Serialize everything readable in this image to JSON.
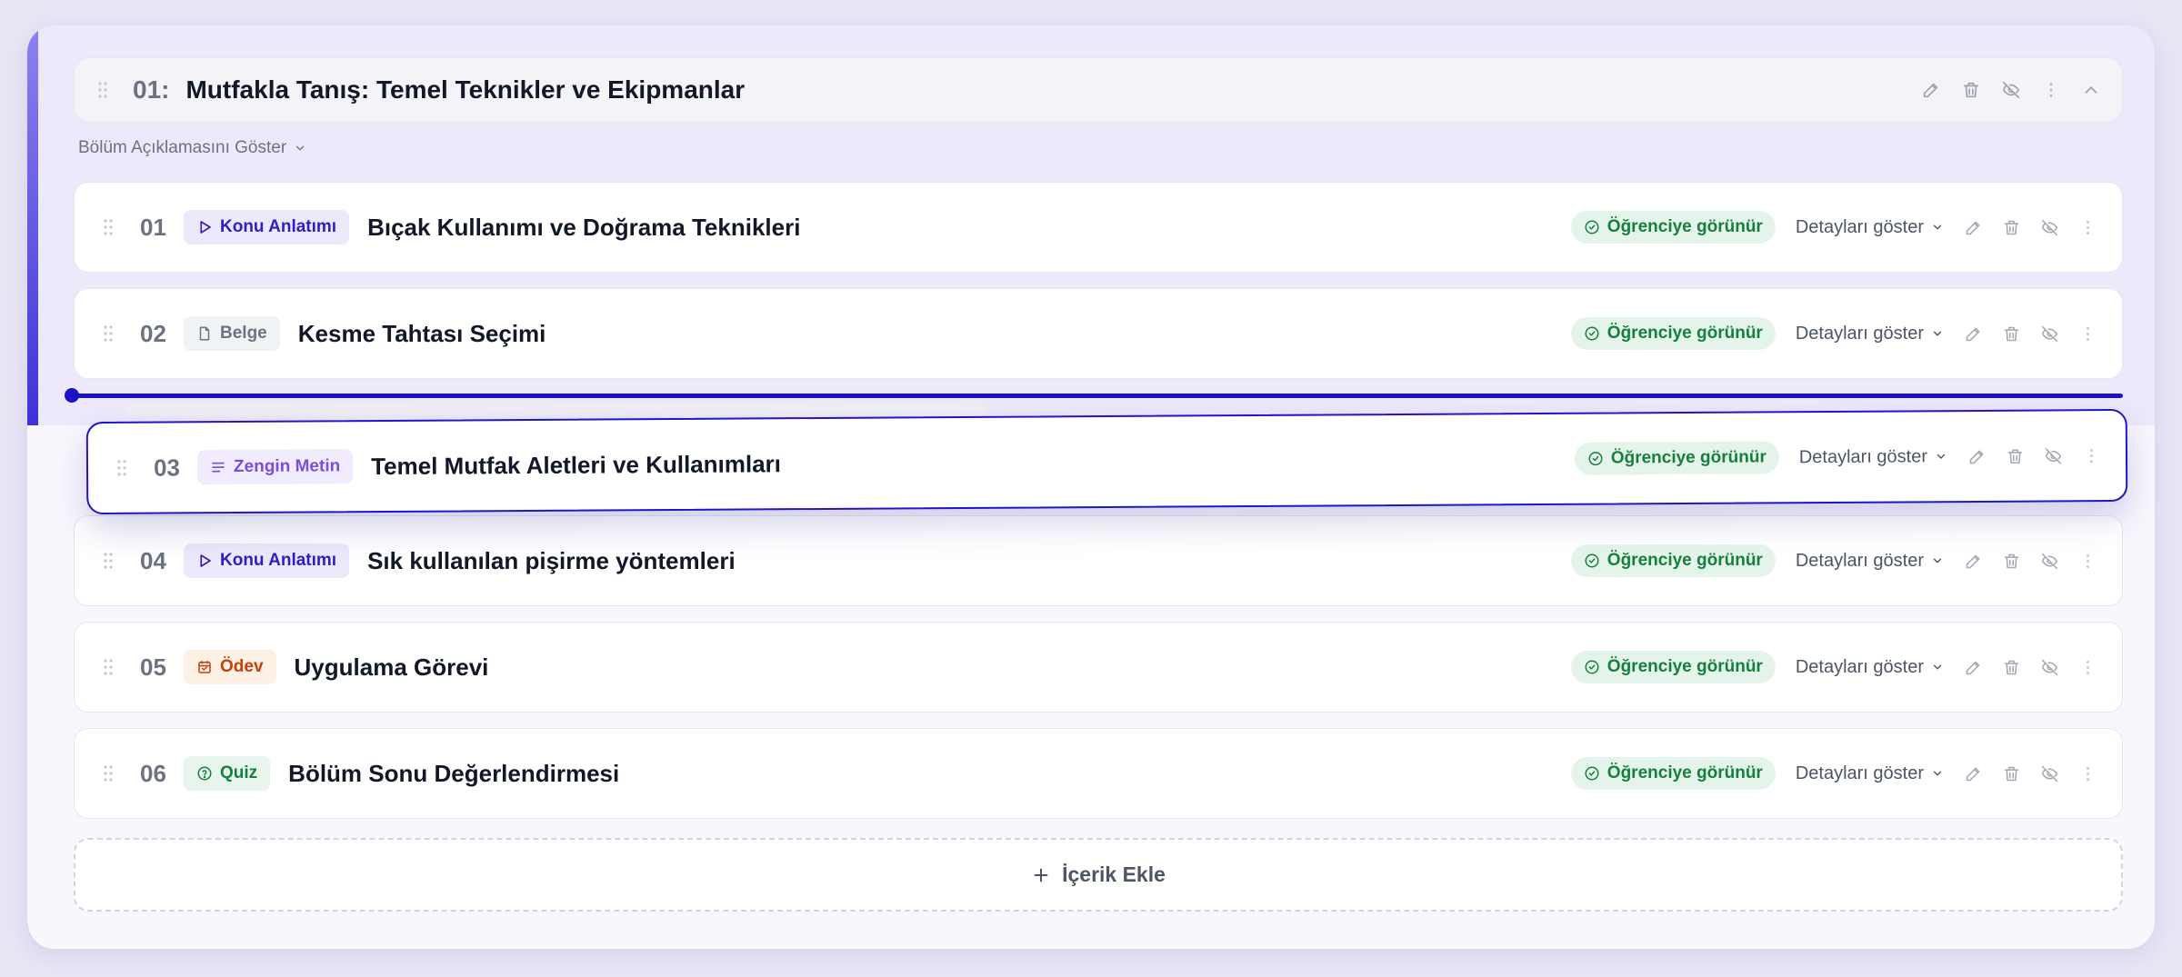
{
  "section": {
    "number": "01:",
    "title": "Mutfakla Tanış: Temel Teknikler ve Ekipmanlar",
    "show_description_label": "Bölüm Açıklamasını Göster"
  },
  "status_label": "Öğrenciye görünür",
  "details_label": "Detayları göster",
  "items": [
    {
      "num": "01",
      "type": "Konu Anlatımı",
      "type_icon": "play-icon",
      "title": "Bıçak Kullanımı ve Doğrama Teknikleri",
      "badge_bg": "#ece9fb",
      "badge_fg": "#2d1fc7"
    },
    {
      "num": "02",
      "type": "Belge",
      "type_icon": "document-icon",
      "title": "Kesme Tahtası Seçimi",
      "badge_bg": "#f1f2f5",
      "badge_fg": "#6b7280"
    },
    {
      "num": "03",
      "type": "Zengin Metin",
      "type_icon": "text-lines-icon",
      "title": "Temel Mutfak Aletleri ve Kullanımları",
      "badge_bg": "#f1ecfd",
      "badge_fg": "#7c4ddb"
    },
    {
      "num": "04",
      "type": "Konu Anlatımı",
      "type_icon": "play-icon",
      "title": "Sık kullanılan pişirme yöntemleri",
      "badge_bg": "#ece9fb",
      "badge_fg": "#2d1fc7"
    },
    {
      "num": "05",
      "type": "Ödev",
      "type_icon": "calendar-icon",
      "title": "Uygulama Görevi",
      "badge_bg": "#fdf0e4",
      "badge_fg": "#c2410c"
    },
    {
      "num": "06",
      "type": "Quiz",
      "type_icon": "question-circle-icon",
      "title": "Bölüm Sonu Değerlendirmesi",
      "badge_bg": "#e7f5ec",
      "badge_fg": "#15803d"
    }
  ],
  "add_content_label": "İçerik Ekle",
  "colors": {
    "accent": "#1a12c4",
    "status_bg": "#e5f4ea",
    "status_fg": "#15803d"
  }
}
